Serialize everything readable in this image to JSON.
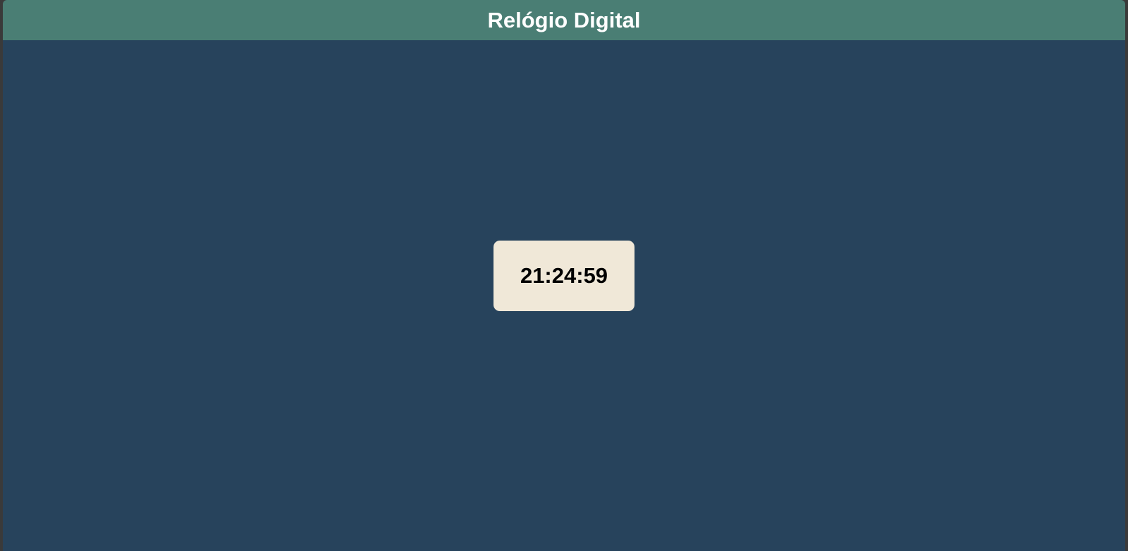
{
  "header": {
    "title": "Relógio Digital"
  },
  "clock": {
    "time": "21:24:59"
  },
  "colors": {
    "header_bg": "#4a7e74",
    "page_bg": "#27435c",
    "card_bg": "#f0e8d8"
  }
}
